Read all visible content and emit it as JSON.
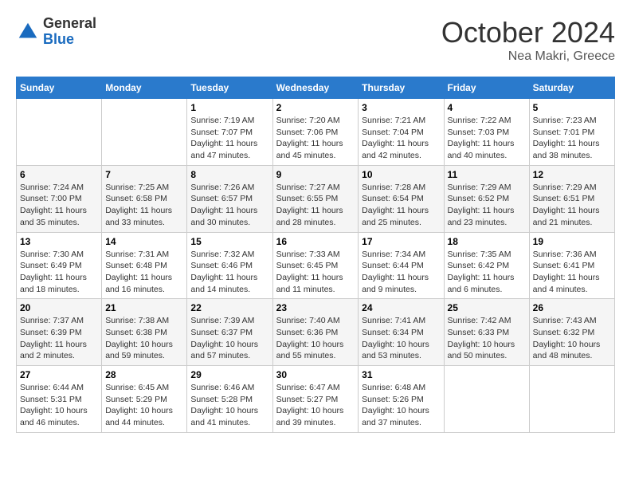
{
  "header": {
    "logo_general": "General",
    "logo_blue": "Blue",
    "title": "October 2024",
    "location": "Nea Makri, Greece"
  },
  "weekdays": [
    "Sunday",
    "Monday",
    "Tuesday",
    "Wednesday",
    "Thursday",
    "Friday",
    "Saturday"
  ],
  "weeks": [
    [
      {
        "day": null,
        "sunrise": null,
        "sunset": null,
        "daylight": null
      },
      {
        "day": null,
        "sunrise": null,
        "sunset": null,
        "daylight": null
      },
      {
        "day": "1",
        "sunrise": "Sunrise: 7:19 AM",
        "sunset": "Sunset: 7:07 PM",
        "daylight": "Daylight: 11 hours and 47 minutes."
      },
      {
        "day": "2",
        "sunrise": "Sunrise: 7:20 AM",
        "sunset": "Sunset: 7:06 PM",
        "daylight": "Daylight: 11 hours and 45 minutes."
      },
      {
        "day": "3",
        "sunrise": "Sunrise: 7:21 AM",
        "sunset": "Sunset: 7:04 PM",
        "daylight": "Daylight: 11 hours and 42 minutes."
      },
      {
        "day": "4",
        "sunrise": "Sunrise: 7:22 AM",
        "sunset": "Sunset: 7:03 PM",
        "daylight": "Daylight: 11 hours and 40 minutes."
      },
      {
        "day": "5",
        "sunrise": "Sunrise: 7:23 AM",
        "sunset": "Sunset: 7:01 PM",
        "daylight": "Daylight: 11 hours and 38 minutes."
      }
    ],
    [
      {
        "day": "6",
        "sunrise": "Sunrise: 7:24 AM",
        "sunset": "Sunset: 7:00 PM",
        "daylight": "Daylight: 11 hours and 35 minutes."
      },
      {
        "day": "7",
        "sunrise": "Sunrise: 7:25 AM",
        "sunset": "Sunset: 6:58 PM",
        "daylight": "Daylight: 11 hours and 33 minutes."
      },
      {
        "day": "8",
        "sunrise": "Sunrise: 7:26 AM",
        "sunset": "Sunset: 6:57 PM",
        "daylight": "Daylight: 11 hours and 30 minutes."
      },
      {
        "day": "9",
        "sunrise": "Sunrise: 7:27 AM",
        "sunset": "Sunset: 6:55 PM",
        "daylight": "Daylight: 11 hours and 28 minutes."
      },
      {
        "day": "10",
        "sunrise": "Sunrise: 7:28 AM",
        "sunset": "Sunset: 6:54 PM",
        "daylight": "Daylight: 11 hours and 25 minutes."
      },
      {
        "day": "11",
        "sunrise": "Sunrise: 7:29 AM",
        "sunset": "Sunset: 6:52 PM",
        "daylight": "Daylight: 11 hours and 23 minutes."
      },
      {
        "day": "12",
        "sunrise": "Sunrise: 7:29 AM",
        "sunset": "Sunset: 6:51 PM",
        "daylight": "Daylight: 11 hours and 21 minutes."
      }
    ],
    [
      {
        "day": "13",
        "sunrise": "Sunrise: 7:30 AM",
        "sunset": "Sunset: 6:49 PM",
        "daylight": "Daylight: 11 hours and 18 minutes."
      },
      {
        "day": "14",
        "sunrise": "Sunrise: 7:31 AM",
        "sunset": "Sunset: 6:48 PM",
        "daylight": "Daylight: 11 hours and 16 minutes."
      },
      {
        "day": "15",
        "sunrise": "Sunrise: 7:32 AM",
        "sunset": "Sunset: 6:46 PM",
        "daylight": "Daylight: 11 hours and 14 minutes."
      },
      {
        "day": "16",
        "sunrise": "Sunrise: 7:33 AM",
        "sunset": "Sunset: 6:45 PM",
        "daylight": "Daylight: 11 hours and 11 minutes."
      },
      {
        "day": "17",
        "sunrise": "Sunrise: 7:34 AM",
        "sunset": "Sunset: 6:44 PM",
        "daylight": "Daylight: 11 hours and 9 minutes."
      },
      {
        "day": "18",
        "sunrise": "Sunrise: 7:35 AM",
        "sunset": "Sunset: 6:42 PM",
        "daylight": "Daylight: 11 hours and 6 minutes."
      },
      {
        "day": "19",
        "sunrise": "Sunrise: 7:36 AM",
        "sunset": "Sunset: 6:41 PM",
        "daylight": "Daylight: 11 hours and 4 minutes."
      }
    ],
    [
      {
        "day": "20",
        "sunrise": "Sunrise: 7:37 AM",
        "sunset": "Sunset: 6:39 PM",
        "daylight": "Daylight: 11 hours and 2 minutes."
      },
      {
        "day": "21",
        "sunrise": "Sunrise: 7:38 AM",
        "sunset": "Sunset: 6:38 PM",
        "daylight": "Daylight: 10 hours and 59 minutes."
      },
      {
        "day": "22",
        "sunrise": "Sunrise: 7:39 AM",
        "sunset": "Sunset: 6:37 PM",
        "daylight": "Daylight: 10 hours and 57 minutes."
      },
      {
        "day": "23",
        "sunrise": "Sunrise: 7:40 AM",
        "sunset": "Sunset: 6:36 PM",
        "daylight": "Daylight: 10 hours and 55 minutes."
      },
      {
        "day": "24",
        "sunrise": "Sunrise: 7:41 AM",
        "sunset": "Sunset: 6:34 PM",
        "daylight": "Daylight: 10 hours and 53 minutes."
      },
      {
        "day": "25",
        "sunrise": "Sunrise: 7:42 AM",
        "sunset": "Sunset: 6:33 PM",
        "daylight": "Daylight: 10 hours and 50 minutes."
      },
      {
        "day": "26",
        "sunrise": "Sunrise: 7:43 AM",
        "sunset": "Sunset: 6:32 PM",
        "daylight": "Daylight: 10 hours and 48 minutes."
      }
    ],
    [
      {
        "day": "27",
        "sunrise": "Sunrise: 6:44 AM",
        "sunset": "Sunset: 5:31 PM",
        "daylight": "Daylight: 10 hours and 46 minutes."
      },
      {
        "day": "28",
        "sunrise": "Sunrise: 6:45 AM",
        "sunset": "Sunset: 5:29 PM",
        "daylight": "Daylight: 10 hours and 44 minutes."
      },
      {
        "day": "29",
        "sunrise": "Sunrise: 6:46 AM",
        "sunset": "Sunset: 5:28 PM",
        "daylight": "Daylight: 10 hours and 41 minutes."
      },
      {
        "day": "30",
        "sunrise": "Sunrise: 6:47 AM",
        "sunset": "Sunset: 5:27 PM",
        "daylight": "Daylight: 10 hours and 39 minutes."
      },
      {
        "day": "31",
        "sunrise": "Sunrise: 6:48 AM",
        "sunset": "Sunset: 5:26 PM",
        "daylight": "Daylight: 10 hours and 37 minutes."
      },
      {
        "day": null,
        "sunrise": null,
        "sunset": null,
        "daylight": null
      },
      {
        "day": null,
        "sunrise": null,
        "sunset": null,
        "daylight": null
      }
    ]
  ]
}
